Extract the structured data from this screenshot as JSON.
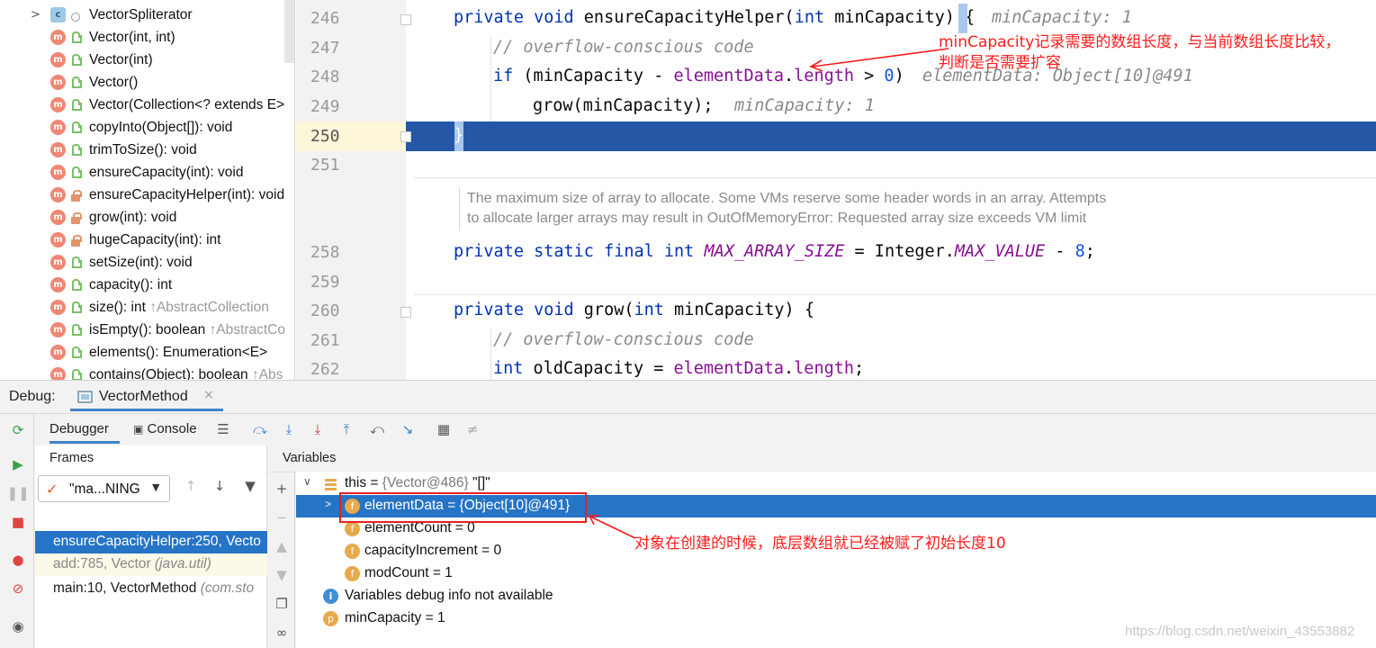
{
  "structure": {
    "items": [
      {
        "icon": "c",
        "vis": "circ",
        "label": "VectorSpliterator",
        "suffix": "",
        "expand": true
      },
      {
        "icon": "m",
        "vis": "pub",
        "label": "Vector(int, int)",
        "suffix": ""
      },
      {
        "icon": "m",
        "vis": "pub",
        "label": "Vector(int)",
        "suffix": ""
      },
      {
        "icon": "m",
        "vis": "pub",
        "label": "Vector()",
        "suffix": ""
      },
      {
        "icon": "m",
        "vis": "pub",
        "label": "Vector(Collection<? extends E>",
        "suffix": ""
      },
      {
        "icon": "m",
        "vis": "pub",
        "label": "copyInto(Object[]): void",
        "suffix": ""
      },
      {
        "icon": "m",
        "vis": "pub",
        "label": "trimToSize(): void",
        "suffix": ""
      },
      {
        "icon": "m",
        "vis": "pub",
        "label": "ensureCapacity(int): void",
        "suffix": ""
      },
      {
        "icon": "m",
        "vis": "priv",
        "label": "ensureCapacityHelper(int): void",
        "suffix": ""
      },
      {
        "icon": "m",
        "vis": "priv",
        "label": "grow(int): void",
        "suffix": ""
      },
      {
        "icon": "m",
        "vis": "priv",
        "label": "hugeCapacity(int): int",
        "suffix": ""
      },
      {
        "icon": "m",
        "vis": "pub",
        "label": "setSize(int): void",
        "suffix": ""
      },
      {
        "icon": "m",
        "vis": "pub",
        "label": "capacity(): int",
        "suffix": ""
      },
      {
        "icon": "m",
        "vis": "pub",
        "label": "size(): int ",
        "suffix": "↑AbstractCollection"
      },
      {
        "icon": "m",
        "vis": "pub",
        "label": "isEmpty(): boolean ",
        "suffix": "↑AbstractCo"
      },
      {
        "icon": "m",
        "vis": "pub",
        "label": "elements(): Enumeration<E>",
        "suffix": ""
      },
      {
        "icon": "m",
        "vis": "pub",
        "label": "contains(Object): boolean ",
        "suffix": "↑Abs"
      }
    ]
  },
  "editor": {
    "line_numbers": [
      "246",
      "247",
      "248",
      "249",
      "250",
      "251",
      "258",
      "259",
      "260",
      "261",
      "262"
    ],
    "code": {
      "l246_kw": "private void",
      "l246_name": " ensureCapacityHelper(",
      "l246_kw2": "int",
      "l246_rest": " minCapacity) {",
      "l246_hint": "minCapacity: 1",
      "l247": "// overflow-conscious code",
      "l248_kw": "if",
      "l248_a": " (minCapacity - ",
      "l248_fld": "elementData",
      "l248_b": ".",
      "l248_fld2": "length",
      "l248_c": " > ",
      "l248_num": "0",
      "l248_d": ")",
      "l248_hint": "elementData: Object[10]@491",
      "l249": "grow(minCapacity);",
      "l249_hint": "minCapacity: 1",
      "l250": "}",
      "doc1": "The maximum size of array to allocate. Some VMs reserve some header words in an array. Attempts",
      "doc2": "to allocate larger arrays may result in OutOfMemoryError: Requested array size exceeds VM limit",
      "l258_kw": "private static final int",
      "l258_const": "MAX_ARRAY_SIZE",
      "l258_a": " = Integer.",
      "l258_const2": "MAX_VALUE",
      "l258_b": " - ",
      "l258_num": "8",
      "l258_c": ";",
      "l260_kw": "private void",
      "l260_name": " grow(",
      "l260_kw2": "int",
      "l260_rest": " minCapacity) {",
      "l261": "// overflow-conscious code",
      "l262_kw": "int",
      "l262_a": " oldCapacity = ",
      "l262_fld": "elementData",
      "l262_b": ".",
      "l262_fld2": "length",
      "l262_c": ";"
    },
    "annotation_top_1": "minCapacity记录需要的数组长度，与当前数组长度比较，",
    "annotation_top_2": "判断是否需要扩容"
  },
  "debug": {
    "title": "Debug:",
    "tab_label": "VectorMethod",
    "tab_close": "×",
    "debugger_tab": "Debugger",
    "console_tab": "Console",
    "frames_header": "Frames",
    "variables_header": "Variables",
    "thread": "\"ma...NING",
    "frames": [
      {
        "text": "ensureCapacityHelper:250, Vecto",
        "pkg": ""
      },
      {
        "text": "add:785, Vector ",
        "pkg": "(java.util)"
      },
      {
        "text": "main:10, VectorMethod ",
        "pkg": "(com.sto"
      }
    ],
    "vars": {
      "this_name": "this",
      "this_eq": " = ",
      "this_val": "{Vector@486}",
      "this_str": " \"[]\"",
      "elementData": "elementData = {Object[10]@491}",
      "elementCount": "elementCount = 0",
      "capacityIncrement": "capacityIncrement = 0",
      "modCount": "modCount = 1",
      "info": "Variables debug info not available",
      "minCapacity": "minCapacity = 1"
    },
    "annotation": "对象在创建的时候，底层数组就已经被赋了初始长度10",
    "watermark": "https://blog.csdn.net/weixin_43553882"
  }
}
